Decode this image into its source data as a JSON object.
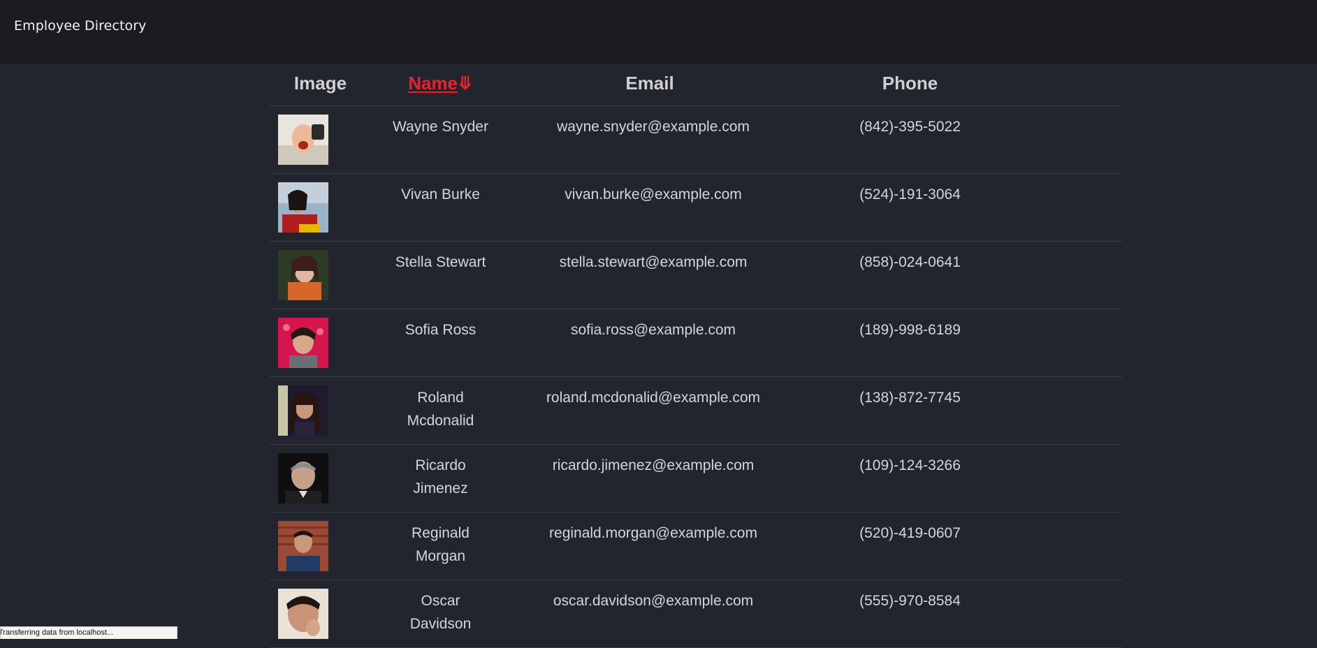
{
  "app": {
    "title": "Employee Directory"
  },
  "table": {
    "headers": {
      "image": "Image",
      "name": "Name",
      "email": "Email",
      "phone": "Phone"
    },
    "sort_icon": "⤋",
    "sort_column": "name",
    "sort_direction": "descending",
    "rows": [
      {
        "name": "Wayne Snyder",
        "email": "wayne.snyder@example.com",
        "phone": "(842)-395-5022"
      },
      {
        "name": "Vivan Burke",
        "email": "vivan.burke@example.com",
        "phone": "(524)-191-3064"
      },
      {
        "name": "Stella Stewart",
        "email": "stella.stewart@example.com",
        "phone": "(858)-024-0641"
      },
      {
        "name": "Sofia Ross",
        "email": "sofia.ross@example.com",
        "phone": "(189)-998-6189"
      },
      {
        "name": "Roland Mcdonalid",
        "email": "roland.mcdonalid@example.com",
        "phone": "(138)-872-7745"
      },
      {
        "name": "Ricardo Jimenez",
        "email": "ricardo.jimenez@example.com",
        "phone": "(109)-124-3266"
      },
      {
        "name": "Reginald Morgan",
        "email": "reginald.morgan@example.com",
        "phone": "(520)-419-0607"
      },
      {
        "name": "Oscar Davidson",
        "email": "oscar.davidson@example.com",
        "phone": "(555)-970-8584"
      }
    ]
  },
  "status": {
    "text": "Transferring data from localhost..."
  },
  "colors": {
    "page_bg": "#22252e",
    "navbar_bg": "#1b1c1f",
    "sort_accent": "#e8222b",
    "text": "#d6d6d6"
  }
}
